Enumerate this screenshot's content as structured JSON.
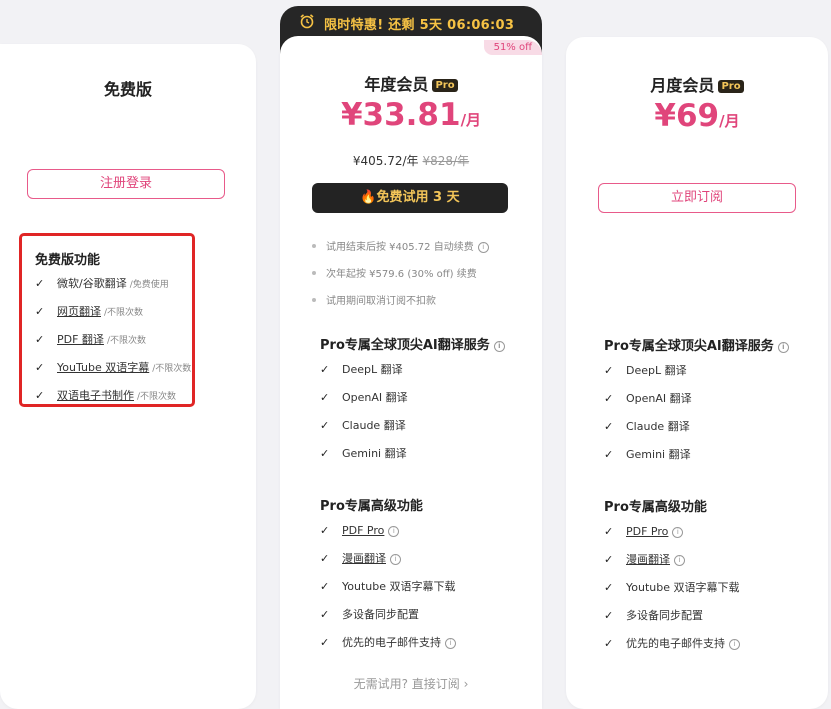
{
  "free": {
    "title": "免费版",
    "button": "注册登录",
    "features_title": "免费版功能",
    "features": [
      {
        "label": "微软/谷歌翻译",
        "note": "/免费使用",
        "underline": false
      },
      {
        "label": "网页翻译",
        "note": "/不限次数",
        "underline": true
      },
      {
        "label": "PDF 翻译",
        "note": "/不限次数",
        "underline": true
      },
      {
        "label": "YouTube 双语字幕",
        "note": "/不限次数",
        "underline": true
      },
      {
        "label": "双语电子书制作",
        "note": "/不限次数",
        "underline": true
      }
    ]
  },
  "annual": {
    "promo": "限时特惠! 还剩 5天 06:06:03",
    "off_badge": "51% off",
    "title": "年度会员",
    "badge": "Pro",
    "price": "¥33.81",
    "price_unit": "/月",
    "yearly_price": "¥405.72/年",
    "original_price": "¥828/年",
    "button": "🔥免费试用 3 天",
    "notes": [
      "试用结束后按 ¥405.72 自动续费",
      "次年起按 ¥579.6 (30% off) 续费",
      "试用期间取消订阅不扣款"
    ],
    "ai_title": "Pro专属全球顶尖AI翻译服务",
    "ai_items": [
      "DeepL 翻译",
      "OpenAI 翻译",
      "Claude 翻译",
      "Gemini 翻译"
    ],
    "adv_title": "Pro专属高级功能",
    "adv_items": [
      "PDF Pro",
      "漫画翻译",
      "Youtube 双语字幕下载",
      "多设备同步配置",
      "优先的电子邮件支持"
    ],
    "bottom_link": "无需试用? 直接订阅 ›"
  },
  "monthly": {
    "title": "月度会员",
    "badge": "Pro",
    "price": "¥69",
    "price_unit": "/月",
    "button": "立即订阅",
    "ai_title": "Pro专属全球顶尖AI翻译服务",
    "ai_items": [
      "DeepL 翻译",
      "OpenAI 翻译",
      "Claude 翻译",
      "Gemini 翻译"
    ],
    "adv_title": "Pro专属高级功能",
    "adv_items": [
      "PDF Pro",
      "漫画翻译",
      "Youtube 双语字幕下载",
      "多设备同步配置",
      "优先的电子邮件支持"
    ]
  },
  "check_glyph": "✓",
  "info_glyph": "i",
  "colors": {
    "accent": "#e0457b",
    "gold": "#f3c559",
    "highlight_border": "#e02525"
  }
}
